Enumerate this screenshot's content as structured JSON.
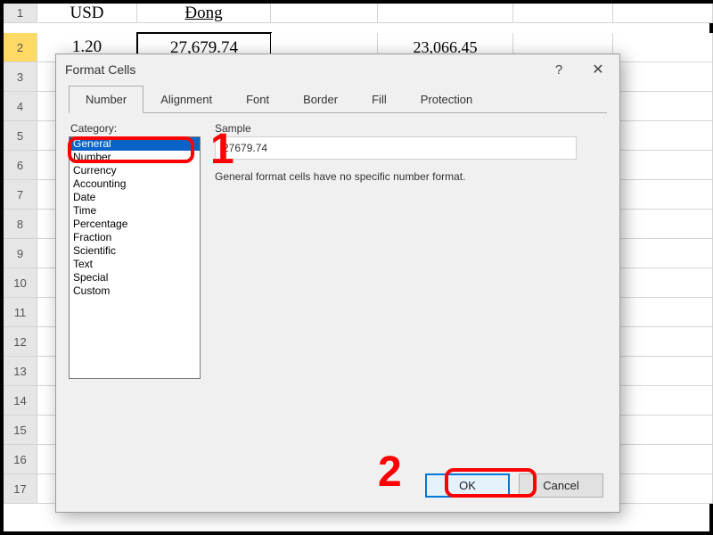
{
  "spreadsheet": {
    "row_labels": [
      "1",
      "2",
      "3",
      "4",
      "5",
      "6",
      "7",
      "8",
      "9",
      "10",
      "11",
      "12",
      "13",
      "14",
      "15",
      "16",
      "17"
    ],
    "header": {
      "b": "USD",
      "c": "Đong"
    },
    "row2": {
      "b": "1.20",
      "c": "27,679.74",
      "e": "23,066.45"
    }
  },
  "dialog": {
    "title": "Format Cells",
    "help": "?",
    "close": "✕",
    "tabs": [
      "Number",
      "Alignment",
      "Font",
      "Border",
      "Fill",
      "Protection"
    ],
    "active_tab": 0,
    "category_label": "Category:",
    "categories": [
      "General",
      "Number",
      "Currency",
      "Accounting",
      "Date",
      "Time",
      "Percentage",
      "Fraction",
      "Scientific",
      "Text",
      "Special",
      "Custom"
    ],
    "selected_category": 0,
    "sample_label": "Sample",
    "sample_value": "27679.74",
    "description": "General format cells have no specific number format.",
    "ok_label": "OK",
    "cancel_label": "Cancel"
  },
  "annotations": {
    "n1": "1",
    "n2": "2"
  }
}
